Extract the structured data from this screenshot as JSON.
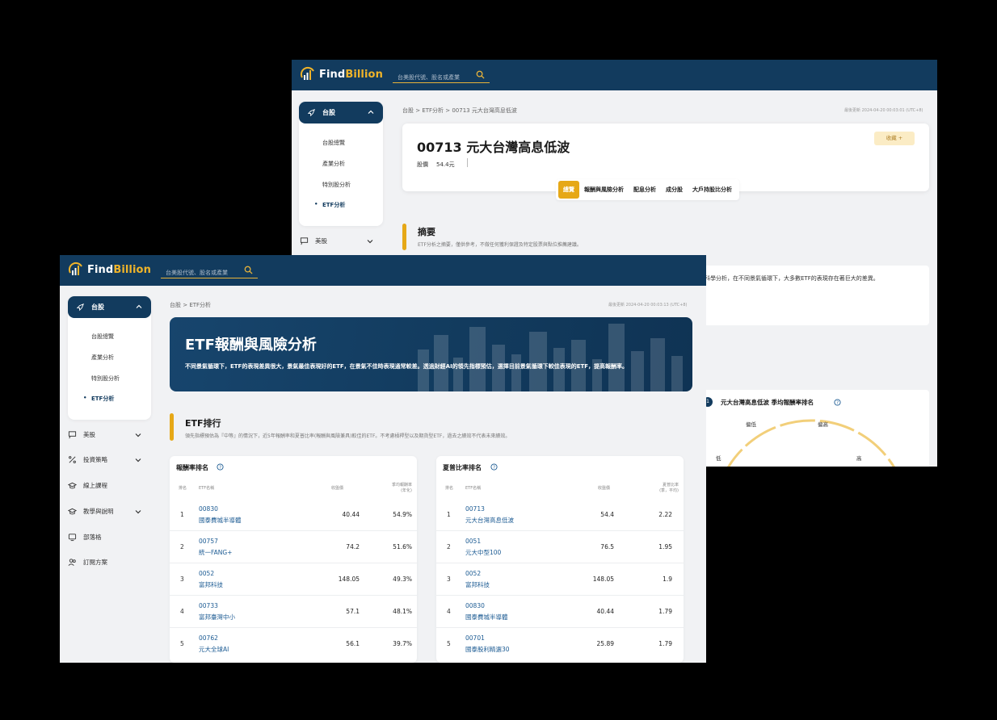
{
  "brand": {
    "name_main": "Find",
    "name_accent": "Billion"
  },
  "search": {
    "placeholder": "台美股代號、股名或產業"
  },
  "sidebar": {
    "active": {
      "label": "台股"
    },
    "sub_items": [
      {
        "label": "台股總覽"
      },
      {
        "label": "產業分析"
      },
      {
        "label": "特別股分析"
      },
      {
        "label": "ETF分析"
      }
    ],
    "items": [
      {
        "label": "美股"
      },
      {
        "label": "投資策略"
      },
      {
        "label": "線上課程"
      },
      {
        "label": "教學與說明"
      },
      {
        "label": "部落格"
      },
      {
        "label": "訂閱方案"
      }
    ]
  },
  "back": {
    "breadcrumb": "台股 > ETF分析 > 00713 元大台灣高息低波",
    "updated": "最後更新 2024-04-20 00:03:01 (UTC+8)",
    "stock_title": "00713 元大台灣高息低波",
    "price_label": "股價",
    "price_value": "54.4元",
    "fav_label": "收藏 +",
    "tabs": [
      {
        "label": "總覽"
      },
      {
        "label": "報酬與風險分析"
      },
      {
        "label": "配息分析"
      },
      {
        "label": "成分股"
      },
      {
        "label": "大戶持股比分析"
      }
    ],
    "summary_title": "摘要",
    "summary_desc": "ETF分析之摘要，僅供參考，不做任何獲利保證及特定股票與點位推薦建議。",
    "summary_text": "科學分析，在不同景氣循環下，大多數ETF的表現存在著巨大的差異。",
    "rank_badge": "1",
    "rank_title": "元大台灣高息低波 季均報酬率排名",
    "gauge_labels": {
      "low": "低",
      "mid_low": "偏低",
      "mid_high": "偏高",
      "high": "高"
    }
  },
  "front": {
    "breadcrumb": "台股 > ETF分析",
    "updated": "最後更新 2024-04-20 00:03:13 (UTC+8)",
    "hero_title": "ETF報酬與風險分析",
    "hero_desc": "不同景氣循環下，ETF的表現差異很大，景氣最佳表現好的ETF，在景氣不佳時表現通常較差。透過財經AI的領先指標預估，選擇目前景氣循環下較佳表現的ETF，提高報酬率。",
    "section_title": "ETF排行",
    "section_desc": "領先指標預估為『中等』的情況下，近5年報酬率和夏普比率(報酬與風險兼具)較佳的ETF。不考慮槓桿型以及期貨型ETF，過去之績效不代表未來績效。",
    "return_table": {
      "title": "報酬率排名",
      "headers": {
        "rank": "排名",
        "name": "ETF名稱",
        "price": "收盤價",
        "metric_1": "季均報酬率",
        "metric_2": "(年化)"
      },
      "rows": [
        {
          "rank": "1",
          "code": "00830",
          "name": "國泰費城半導體",
          "price": "40.44",
          "value": "54.9%"
        },
        {
          "rank": "2",
          "code": "00757",
          "name": "統一FANG+",
          "price": "74.2",
          "value": "51.6%"
        },
        {
          "rank": "3",
          "code": "0052",
          "name": "富邦科技",
          "price": "148.05",
          "value": "49.3%"
        },
        {
          "rank": "4",
          "code": "00733",
          "name": "富邦臺灣中小",
          "price": "57.1",
          "value": "48.1%"
        },
        {
          "rank": "5",
          "code": "00762",
          "name": "元大全球AI",
          "price": "56.1",
          "value": "39.7%"
        }
      ]
    },
    "sharpe_table": {
      "title": "夏普比率排名",
      "headers": {
        "rank": "排名",
        "name": "ETF名稱",
        "price": "收盤價",
        "metric_1": "夏普比率",
        "metric_2": "(季，平均)"
      },
      "rows": [
        {
          "rank": "1",
          "code": "00713",
          "name": "元大台灣高息低波",
          "price": "54.4",
          "value": "2.22"
        },
        {
          "rank": "2",
          "code": "0051",
          "name": "元大中型100",
          "price": "76.5",
          "value": "1.95"
        },
        {
          "rank": "3",
          "code": "0052",
          "name": "富邦科技",
          "price": "148.05",
          "value": "1.9"
        },
        {
          "rank": "4",
          "code": "00830",
          "name": "國泰費城半導體",
          "price": "40.44",
          "value": "1.79"
        },
        {
          "rank": "5",
          "code": "00701",
          "name": "國泰股利精選30",
          "price": "25.89",
          "value": "1.79"
        }
      ]
    }
  },
  "colors": {
    "navy": "#123b5e",
    "gold": "#e6a817",
    "link": "#1c5b93"
  }
}
